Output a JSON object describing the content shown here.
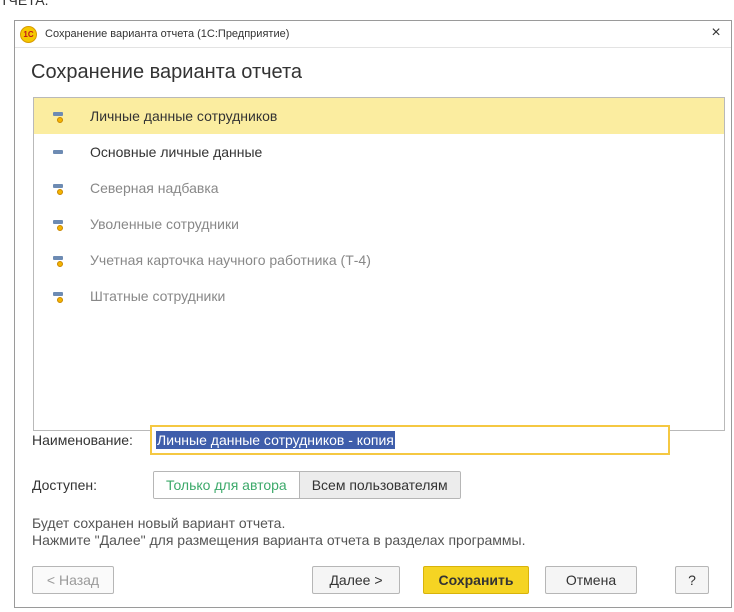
{
  "top_crop_text": "ТЧЕТА.",
  "window": {
    "title": "Сохранение варианта отчета  (1С:Предприятие)",
    "logo_text": "1С",
    "close_label": "×"
  },
  "heading": "Сохранение варианта отчета",
  "variants": [
    {
      "label": "Личные данные сотрудников",
      "icon": "variant-user-icon",
      "selected": true
    },
    {
      "label": "Основные личные данные",
      "icon": "variant-standard-icon",
      "active": true
    },
    {
      "label": "Северная надбавка",
      "icon": "variant-user-icon"
    },
    {
      "label": "Уволенные сотрудники",
      "icon": "variant-user-icon"
    },
    {
      "label": "Учетная карточка научного работника (Т-4)",
      "icon": "variant-user-icon"
    },
    {
      "label": "Штатные сотрудники",
      "icon": "variant-user-icon"
    }
  ],
  "form": {
    "name_label": "Наименование:",
    "name_value": "Личные данные сотрудников - копия",
    "available_label": "Доступен:",
    "available_options": [
      "Только для автора",
      "Всем пользователям"
    ],
    "available_selected": "Только для автора"
  },
  "info": {
    "line1": "Будет сохранен новый вариант отчета.",
    "line2": "Нажмите \"Далее\" для размещения варианта отчета в разделах программы."
  },
  "buttons": {
    "back": "< Назад",
    "next": "Далее >",
    "save": "Сохранить",
    "cancel": "Отмена",
    "help": "?"
  },
  "colors": {
    "selected_row": "#fbeda0",
    "primary_button": "#f5d423",
    "input_border": "#f5c842",
    "text_selection": "#3f5eab",
    "active_option": "#3ca96a"
  }
}
